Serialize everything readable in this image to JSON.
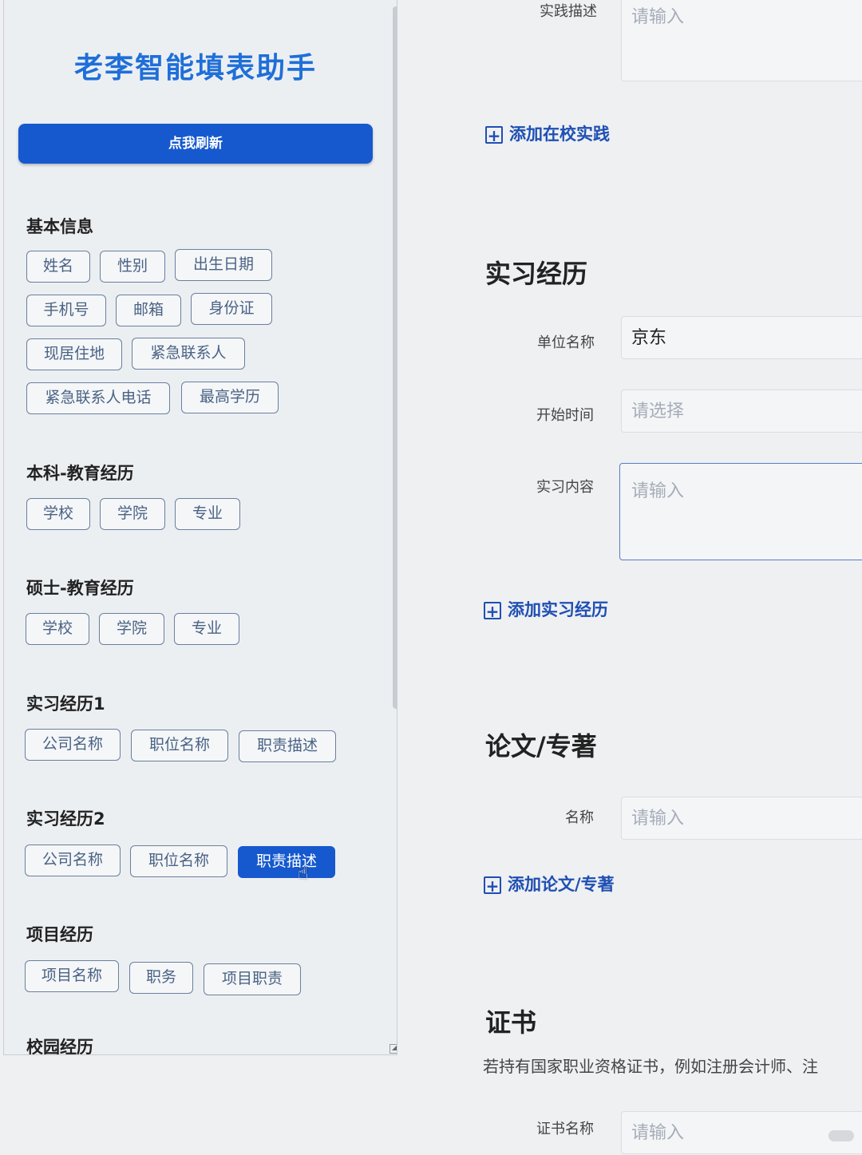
{
  "panel": {
    "title": "老李智能填表助手",
    "refresh_label": "点我刷新",
    "sections": [
      {
        "title": "基本信息",
        "chips": [
          "姓名",
          "性别",
          "出生日期",
          "手机号",
          "邮箱",
          "身份证",
          "现居住地",
          "紧急联系人",
          "紧急联系人电话",
          "最高学历"
        ]
      },
      {
        "title": "本科-教育经历",
        "chips": [
          "学校",
          "学院",
          "专业"
        ]
      },
      {
        "title": "硕士-教育经历",
        "chips": [
          "学校",
          "学院",
          "专业"
        ]
      },
      {
        "title": "实习经历1",
        "chips": [
          "公司名称",
          "职位名称",
          "职责描述"
        ]
      },
      {
        "title": "实习经历2",
        "chips": [
          "公司名称",
          "职位名称",
          "职责描述"
        ]
      },
      {
        "title": "项目经历",
        "chips": [
          "项目名称",
          "职务",
          "项目职责"
        ]
      },
      {
        "title": "校园经历"
      }
    ]
  },
  "form": {
    "practice_desc_label": "实践描述",
    "practice_desc_placeholder": "请输入",
    "add_practice": "添加在校实践",
    "internship_heading": "实习经历",
    "company_label": "单位名称",
    "company_value": "京东",
    "start_label": "开始时间",
    "start_placeholder": "请选择",
    "content_label": "实习内容",
    "content_placeholder": "请输入",
    "add_internship": "添加实习经历",
    "paper_heading": "论文/专著",
    "paper_name_label": "名称",
    "paper_name_placeholder": "请输入",
    "add_paper": "添加论文/专著",
    "cert_heading": "证书",
    "cert_note": "若持有国家职业资格证书，例如注册会计师、注",
    "cert_name_label": "证书名称",
    "cert_name_placeholder": "请输入"
  },
  "colors": {
    "primary": "#1659cf",
    "title": "#1f6fd8",
    "link": "#1f4fb3"
  }
}
